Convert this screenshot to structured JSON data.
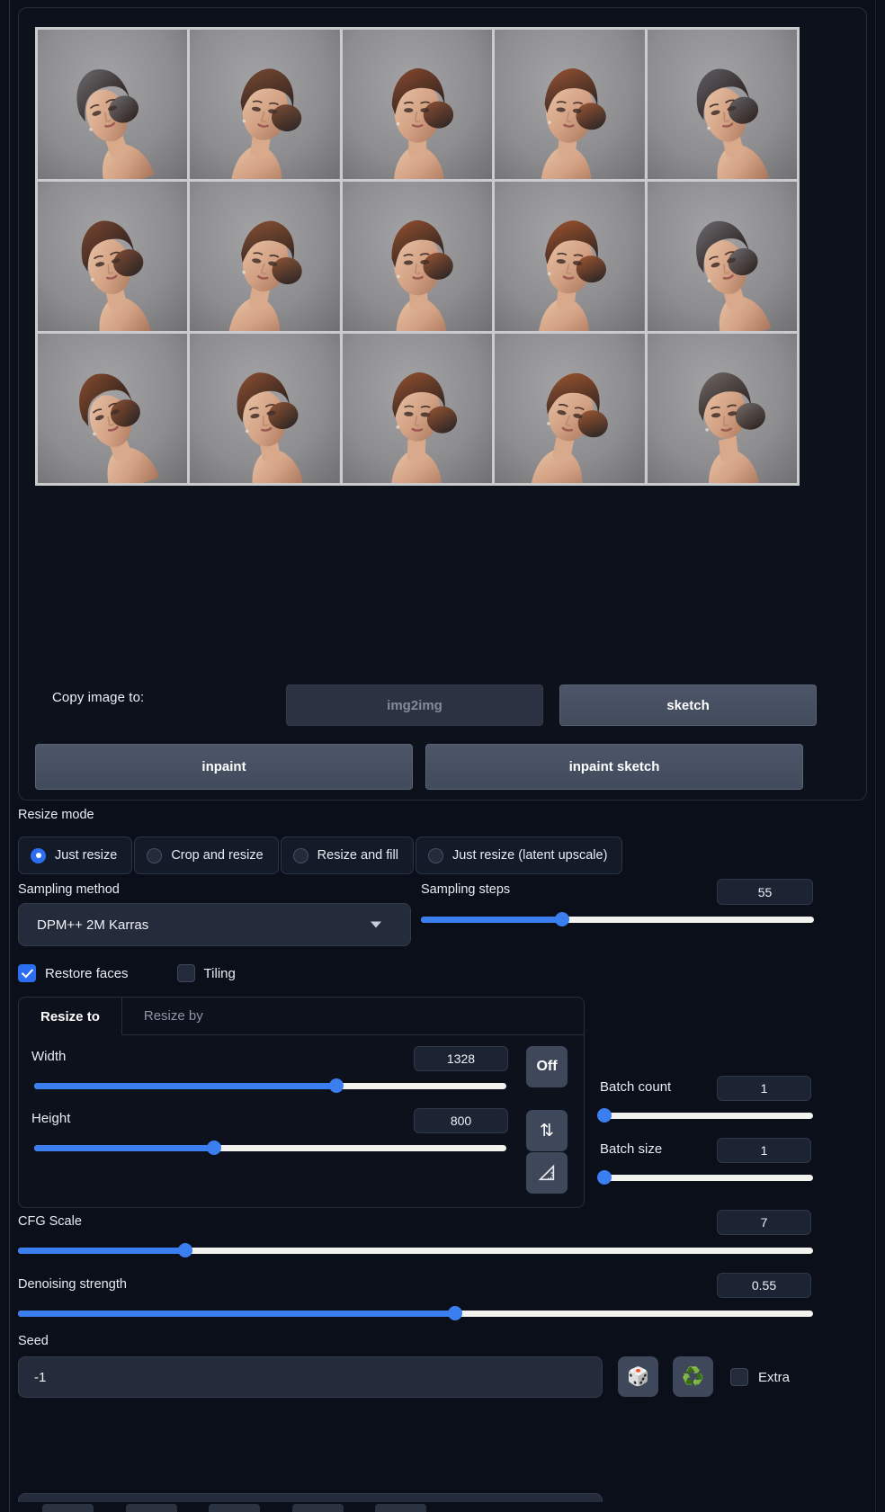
{
  "output": {
    "gallery_rows": 3,
    "gallery_cols": 5,
    "copy_label": "Copy image to:",
    "buttons": {
      "img2img": "img2img",
      "sketch": "sketch",
      "inpaint": "inpaint",
      "inpaint_sketch": "inpaint sketch"
    }
  },
  "resize_mode": {
    "label": "Resize mode",
    "options": [
      {
        "label": "Just resize",
        "selected": true
      },
      {
        "label": "Crop and resize",
        "selected": false
      },
      {
        "label": "Resize and fill",
        "selected": false
      },
      {
        "label": "Just resize (latent upscale)",
        "selected": false
      }
    ]
  },
  "sampling": {
    "method_label": "Sampling method",
    "method_value": "DPM++ 2M Karras",
    "steps_label": "Sampling steps",
    "steps_value": "55",
    "steps_pct": 36
  },
  "toggles": {
    "restore_faces": {
      "label": "Restore faces",
      "checked": true
    },
    "tiling": {
      "label": "Tiling",
      "checked": false
    }
  },
  "resize_to": {
    "tab_resize_to": "Resize to",
    "tab_resize_by": "Resize by",
    "width_label": "Width",
    "width_value": "1328",
    "width_pct": 64,
    "height_label": "Height",
    "height_value": "800",
    "height_pct": 38,
    "aspect_button": "Off",
    "swap_icon": "⇅",
    "ruler_icon": "ruler-triangle"
  },
  "batch": {
    "count_label": "Batch count",
    "count_value": "1",
    "count_pct": 2,
    "size_label": "Batch size",
    "size_value": "1",
    "size_pct": 2
  },
  "cfg": {
    "label": "CFG Scale",
    "value": "7",
    "pct": 21
  },
  "denoise": {
    "label": "Denoising strength",
    "value": "0.55",
    "pct": 55
  },
  "seed": {
    "label": "Seed",
    "value": "-1",
    "dice_icon": "🎲",
    "recycle_icon": "♻️",
    "extra_label": "Extra",
    "extra_checked": false
  },
  "colors": {
    "accent": "#3b7ef0",
    "radio_accent": "#2c6ef2",
    "bg": "#0b0f19",
    "panel": "#0c111c",
    "button": "#4c5668"
  }
}
